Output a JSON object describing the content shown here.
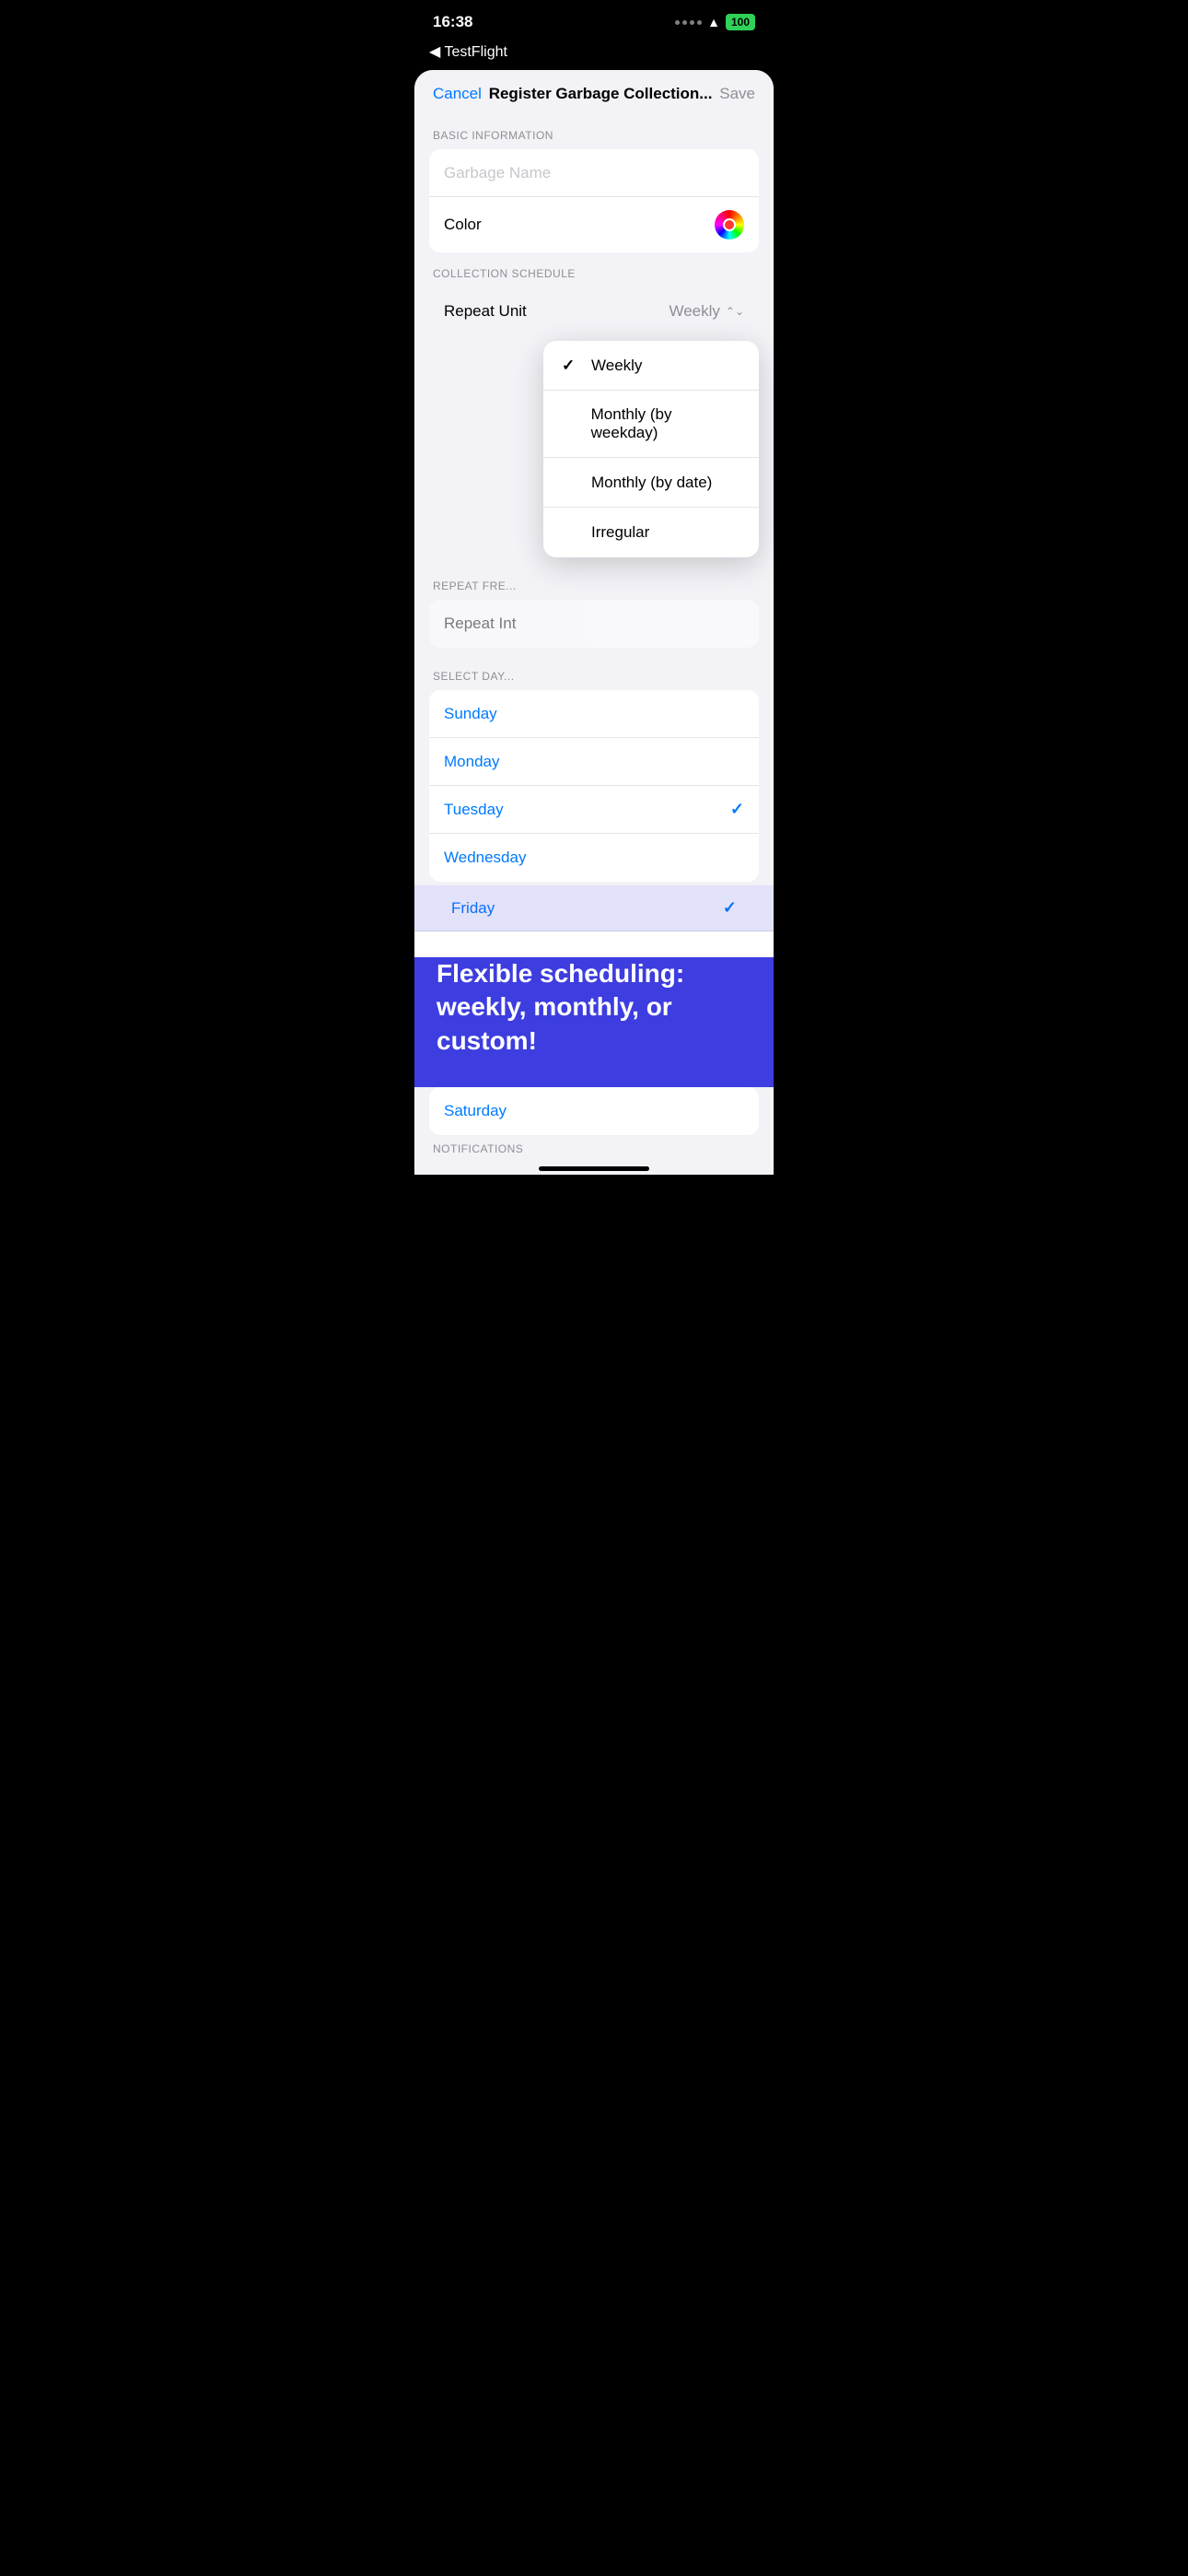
{
  "statusBar": {
    "time": "16:38",
    "battery": "100"
  },
  "nav": {
    "back": "◀ TestFlight",
    "cancel": "Cancel",
    "title": "Register Garbage Collection...",
    "save": "Save"
  },
  "sections": {
    "basicInfo": {
      "label": "BASIC INFORMATION",
      "namePlaceholder": "Garbage Name",
      "colorLabel": "Color"
    },
    "collectionSchedule": {
      "label": "COLLECTION SCHEDULE",
      "repeatUnitLabel": "Repeat Unit",
      "repeatUnitValue": "Weekly"
    },
    "repeatFrequency": {
      "label": "REPEAT FREQUENCY",
      "repeatIntLabel": "Repeat Int"
    },
    "selectDay": {
      "label": "SELECT DAY",
      "days": [
        {
          "name": "Sunday",
          "selected": false
        },
        {
          "name": "Monday",
          "selected": false
        },
        {
          "name": "Tuesday",
          "selected": true
        },
        {
          "name": "Wednesday",
          "selected": false
        },
        {
          "name": "Friday",
          "selected": true
        },
        {
          "name": "Saturday",
          "selected": false
        }
      ]
    },
    "notifications": {
      "label": "NOTIFICATIONS"
    }
  },
  "dropdown": {
    "options": [
      {
        "label": "Weekly",
        "selected": true
      },
      {
        "label": "Monthly (by weekday)",
        "selected": false
      },
      {
        "label": "Monthly (by date)",
        "selected": false
      },
      {
        "label": "Irregular",
        "selected": false
      }
    ]
  },
  "promoBanner": {
    "text": "Flexible scheduling: weekly, monthly, or custom!"
  }
}
